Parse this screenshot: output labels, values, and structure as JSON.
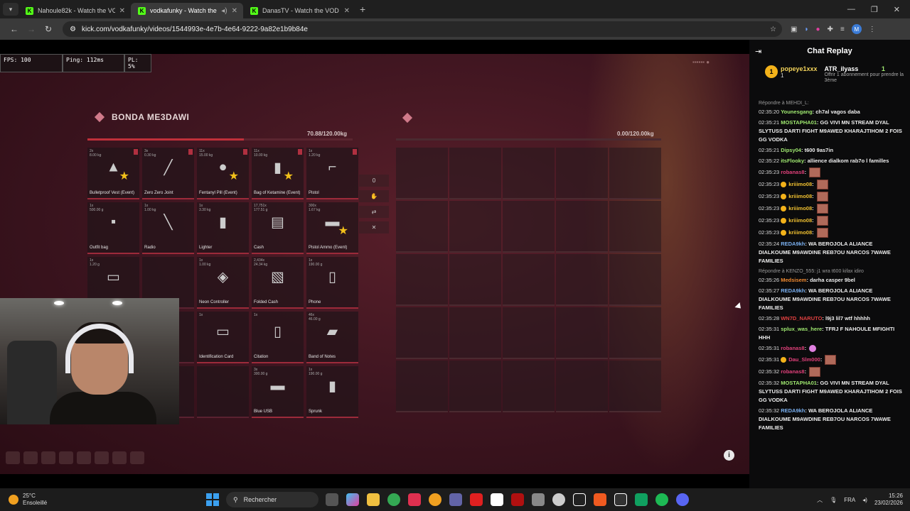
{
  "browser": {
    "tabs": [
      {
        "title": "Nahoule82k - Watch the VOD on",
        "active": false
      },
      {
        "title": "vodkafunky - Watch the VO",
        "active": true
      },
      {
        "title": "DanasTV - Watch the VOD on",
        "active": false
      }
    ],
    "url": "kick.com/vodkafunky/videos/1544993e-4e7b-4e64-9222-9a82e1b9b84e"
  },
  "hud": {
    "fps": "FPS: 100",
    "ping": "Ping: 112ms",
    "pl": "PL: 5%"
  },
  "inventory": {
    "title": "BONDA ME3DAWI",
    "left_weight": "70.88/120.00kg",
    "right_weight": "0.00/120.00kg",
    "counter": "0",
    "items": [
      {
        "label": "Bulletproof Vest (Event)",
        "meta": "2x\n8.00 kg",
        "icon": "vest-icon",
        "glyph": "▲",
        "fav": true
      },
      {
        "label": "Zero Zero Joint",
        "meta": "3x\n0.30 kg",
        "icon": "joint-icon",
        "glyph": "╱",
        "fav": false
      },
      {
        "label": "Fentanyl Pill (Event)",
        "meta": "11x\n15.00 kg",
        "icon": "pill-icon",
        "glyph": "●",
        "fav": true
      },
      {
        "label": "Bag of Ketamine (Event)",
        "meta": "11x\n10.00 kg",
        "icon": "bag-icon",
        "glyph": "▮",
        "fav": true
      },
      {
        "label": "Pistol",
        "meta": "1x\n1.20 kg",
        "icon": "pistol-icon",
        "glyph": "⌐",
        "fav": false
      },
      {
        "label": "Outfit bag",
        "meta": "1x\n500.00 g",
        "icon": "outfit-bag-icon",
        "glyph": "▪",
        "fav": false
      },
      {
        "label": "Radio",
        "meta": "1x\n1.00 kg",
        "icon": "radio-icon",
        "glyph": "╲",
        "fav": false
      },
      {
        "label": "Lighter",
        "meta": "1x\n3.30 kg",
        "icon": "lighter-icon",
        "glyph": "▮",
        "fav": false
      },
      {
        "label": "Cash",
        "meta": "17,751x\n177.51 g",
        "icon": "cash-icon",
        "glyph": "▤",
        "fav": false
      },
      {
        "label": "Pistol Ammo (Event)",
        "meta": "300x\n1.67 kg",
        "icon": "ammo-icon",
        "glyph": "▬",
        "fav": true
      },
      {
        "label": "",
        "meta": "1x\n1.20 g",
        "icon": "paper-icon",
        "glyph": "▭",
        "fav": false
      },
      {
        "label": "",
        "meta": "",
        "icon": "",
        "glyph": "",
        "fav": false
      },
      {
        "label": "Neon Controller",
        "meta": "1x\n1.00 kg",
        "icon": "controller-icon",
        "glyph": "◈",
        "fav": false
      },
      {
        "label": "Folded Cash",
        "meta": "2,434x\n24.34 kg",
        "icon": "folded-cash-icon",
        "glyph": "▧",
        "fav": false
      },
      {
        "label": "Phone",
        "meta": "1x\n190.00 g",
        "icon": "phone-icon",
        "glyph": "▯",
        "fav": false
      },
      {
        "label": "",
        "meta": "",
        "icon": "",
        "glyph": "",
        "fav": false
      },
      {
        "label": "",
        "meta": "",
        "icon": "",
        "glyph": "",
        "fav": false
      },
      {
        "label": "Identification Card",
        "meta": "1x",
        "icon": "id-card-icon",
        "glyph": "▭",
        "fav": false
      },
      {
        "label": "Citation",
        "meta": "1x",
        "icon": "citation-icon",
        "glyph": "▯",
        "fav": false
      },
      {
        "label": "Band of Notes",
        "meta": "46x\n46.00 g",
        "icon": "notes-icon",
        "glyph": "▰",
        "fav": false
      },
      {
        "label": "",
        "meta": "",
        "icon": "",
        "glyph": "",
        "fav": false
      },
      {
        "label": "",
        "meta": "",
        "icon": "",
        "glyph": "",
        "fav": false
      },
      {
        "label": "",
        "meta": "",
        "icon": "",
        "glyph": "",
        "fav": false
      },
      {
        "label": "Blue USB",
        "meta": "3x\n300.00 g",
        "icon": "usb-icon",
        "glyph": "▬",
        "fav": false
      },
      {
        "label": "Sprunk",
        "meta": "1x\n190.00 g",
        "icon": "sprunk-icon",
        "glyph": "▮",
        "fav": false
      }
    ]
  },
  "chat": {
    "title": "Chat Replay",
    "pinned": [
      {
        "badge": "1",
        "name": "popeye1xxx",
        "count": "1"
      },
      {
        "name": "ATR_ilyass",
        "count": "1",
        "text": "Offrir 1 abonnement pour prendre la 3ème"
      }
    ],
    "messages": [
      {
        "reply": "Répondre à MEHDI_L:"
      },
      {
        "time": "02:35:20",
        "user": "Younesgang",
        "color": "#9fe870",
        "text": "ch7al vagos daba"
      },
      {
        "time": "02:35:21",
        "user": "MOSTAPHA01",
        "color": "#9fe870",
        "text": "GG VIVI MN STREAM DYAL SLYTUSS DARTI FIGHT M9AWED KHARAJTIHOM 2 FOIS GG VODKA"
      },
      {
        "time": "02:35:21",
        "user": "Dipsy04",
        "color": "#9fe870",
        "text": "t600 9as7in"
      },
      {
        "time": "02:35:22",
        "user": "itsFlooky",
        "color": "#9fe870",
        "text": "allience dialkom rab7o l familles"
      },
      {
        "time": "02:35:23",
        "user": "robanas8",
        "color": "#e0407a",
        "text": "",
        "emote": true
      },
      {
        "time": "02:35:23",
        "user": "kriiimo08",
        "color": "#f0c030",
        "text": "",
        "emote": true,
        "sub": true
      },
      {
        "time": "02:35:23",
        "user": "kriiimo08",
        "color": "#f0c030",
        "text": "",
        "emote": true,
        "sub": true
      },
      {
        "time": "02:35:23",
        "user": "kriiimo08",
        "color": "#f0c030",
        "text": "",
        "emote": true,
        "sub": true
      },
      {
        "time": "02:35:23",
        "user": "kriiimo08",
        "color": "#f0c030",
        "text": "",
        "emote": true,
        "sub": true
      },
      {
        "time": "02:35:23",
        "user": "kriiimo08",
        "color": "#f0c030",
        "text": "",
        "emote": true,
        "sub": true
      },
      {
        "time": "02:35:24",
        "user": "REDA9kh",
        "color": "#7ab0f0",
        "text": "WA BEROJOLA ALIANCE DIALKOUME M9AWDINE REB7OU NARCOS 7WAWE FAMILIES"
      },
      {
        "reply": "Répondre à KENZO_555: j1 wra t600 kifax idiro"
      },
      {
        "time": "02:35:26",
        "user": "Medsisem",
        "color": "#f08a30",
        "text": "darha casper 9bel"
      },
      {
        "time": "02:35:27",
        "user": "REDA9kh",
        "color": "#7ab0f0",
        "text": "WA BEROJOLA ALIANCE DIALKOUME M9AWDINE REB7OU NARCOS 7WAWE FAMILIES"
      },
      {
        "time": "02:35:28",
        "user": "WN7D_NARUTO",
        "color": "#e04040",
        "text": "l9j3 lil7 wtf hhhhh"
      },
      {
        "time": "02:35:31",
        "user": "splux_was_here",
        "color": "#9fe870",
        "text": "TFRJ F NAHOULE MFIGHTI HHH"
      },
      {
        "time": "02:35:31",
        "user": "robanas8",
        "color": "#e0407a",
        "text": "",
        "pink": true
      },
      {
        "time": "02:35:31",
        "user": "Dau_Slm000",
        "color": "#e0407a",
        "text": "",
        "emote": true,
        "sub": true
      },
      {
        "time": "02:35:32",
        "user": "robanas8",
        "color": "#e0407a",
        "text": "",
        "emote": true
      },
      {
        "time": "02:35:32",
        "user": "MOSTAPHA01",
        "color": "#9fe870",
        "text": "GG VIVI MN STREAM DYAL SLYTUSS DARTI FIGHT M9AWED KHARAJTIHOM 2 FOIS GG VODKA"
      },
      {
        "time": "02:35:32",
        "user": "REDA9kh",
        "color": "#7ab0f0",
        "text": "WA BEROJOLA ALIANCE DIALKOUME M9AWDINE REB7OU NARCOS 7WAWE FAMILIES"
      }
    ]
  },
  "taskbar": {
    "temp": "25°C",
    "weather": "Ensoleillé",
    "search": "Rechercher",
    "lang": "FRA",
    "time": "15:26",
    "date": "23/02/2026"
  }
}
